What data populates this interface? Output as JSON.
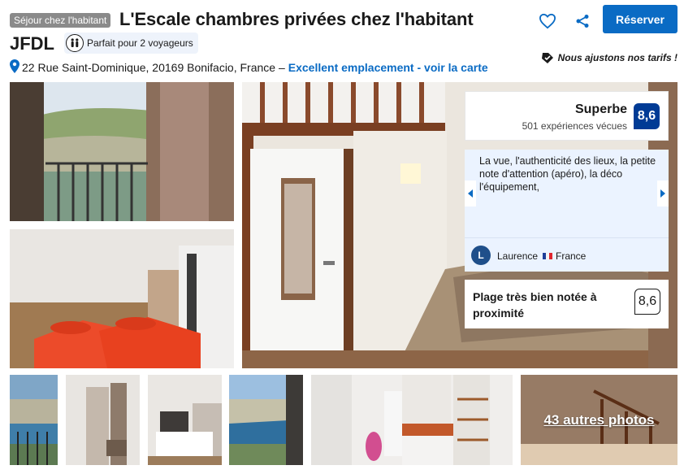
{
  "header": {
    "type_badge": "Séjour chez l'habitant",
    "title_line1": "L'Escale chambres privées chez l'habitant",
    "title_line2": "JFDL",
    "capacity_badge": "Parfait pour 2 voyageurs",
    "reserve_label": "Réserver",
    "price_match": "Nous ajustons nos tarifs !"
  },
  "address": {
    "text": "22 Rue Saint-Dominique, 20169 Bonifacio, France –",
    "link": "Excellent emplacement - voir la carte"
  },
  "score": {
    "label": "Superbe",
    "count": "501 expériences vécues",
    "value": "8,6"
  },
  "review": {
    "text": "La vue, l'authenticité des lieux, la petite note d'attention (apéro), la déco l'équipement,",
    "avatar_letter": "L",
    "author": "Laurence",
    "country": "France"
  },
  "beach": {
    "label": "Plage très bien notée à proximité",
    "value": "8,6"
  },
  "gallery": {
    "more_label": "43 autres photos"
  },
  "colors": {
    "brand_blue": "#0a6bc4",
    "score_blue": "#003b95",
    "review_bg": "#ebf3ff"
  }
}
